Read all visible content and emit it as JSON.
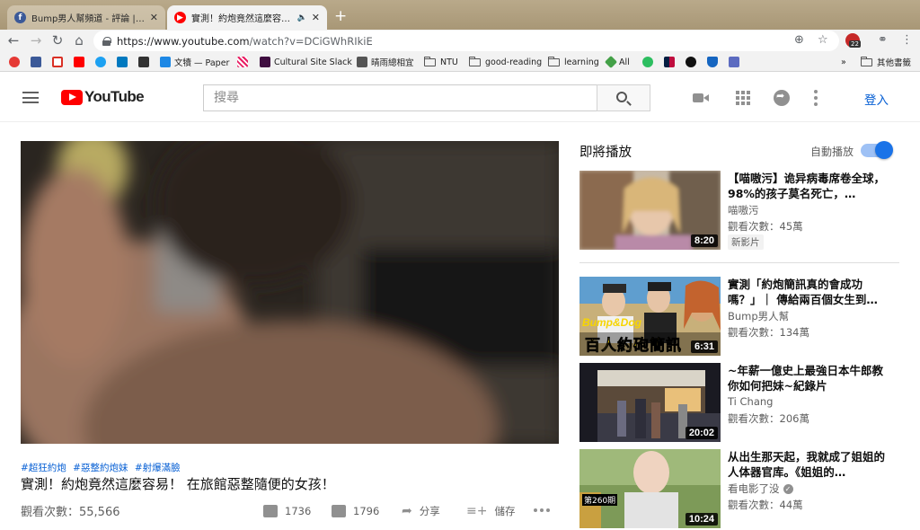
{
  "browser": {
    "tabs": [
      {
        "title": "Bump男人幫頻道 - 評論 | Facebook",
        "active": false
      },
      {
        "title": "實測！約炮竟然這麼容易！ 在旅館惡整",
        "active": true
      }
    ],
    "url_host": "https://www.youtube.com",
    "url_path": "/watch?v=DCiGWhRIkiE",
    "extension_badge": "22",
    "bookmarks": [
      {
        "label": "文犢 — Paper"
      },
      {
        "label": "Cultural Site Slack"
      },
      {
        "label": "晴雨總相宜"
      },
      {
        "label": "NTU"
      },
      {
        "label": "good-reading"
      },
      {
        "label": "learning"
      },
      {
        "label": "All"
      }
    ],
    "bookmarks_overflow": "»",
    "other_bookmarks": "其他書籤"
  },
  "masthead": {
    "logo_text": "YouTube",
    "search_placeholder": "搜尋",
    "sign_in": "登入"
  },
  "video": {
    "hashtags": [
      "#超狂約炮",
      "#惡整約炮妹",
      "#射爆滿臉"
    ],
    "title": "實測！約炮竟然這麼容易！ 在旅館惡整隨便的女孩！",
    "views": "觀看次數：55,566",
    "likes": "1736",
    "dislikes": "1796",
    "share_label": "分享",
    "save_label": "儲存"
  },
  "sidebar": {
    "up_next_label": "即將播放",
    "autoplay_label": "自動播放",
    "autoplay_on": true,
    "items": [
      {
        "title": "【喵嗷污】诡异病毒席卷全球，98%的孩子莫名死亡，…",
        "channel": "喵嗷污",
        "views": "觀看次數：45萬",
        "duration": "8:20",
        "badge": "新影片"
      },
      {
        "title": "實測「約炮簡訊真的會成功嗎？」｜ 傳給兩百個女生到…",
        "channel": "Bump男人幫",
        "views": "觀看次數：134萬",
        "duration": "6:31",
        "thumb_text": "百人約砲簡訊",
        "thumb_brand": "Bump&Dog"
      },
      {
        "title": "~年薪一億史上最強日本牛郎教你如何把妹~紀錄片",
        "channel": "Ti Chang",
        "views": "觀看次數：206萬",
        "duration": "20:02"
      },
      {
        "title": "从出生那天起，我就成了姐姐的人体器官库。《姐姐的…",
        "channel": "看电影了没",
        "views": "觀看次數：44萬",
        "duration": "10:24",
        "thumb_text": "第260期"
      }
    ]
  },
  "colors": {
    "youtube_red": "#ff0000",
    "link_blue": "#065fd4",
    "toggle_blue": "#1a73e8"
  }
}
